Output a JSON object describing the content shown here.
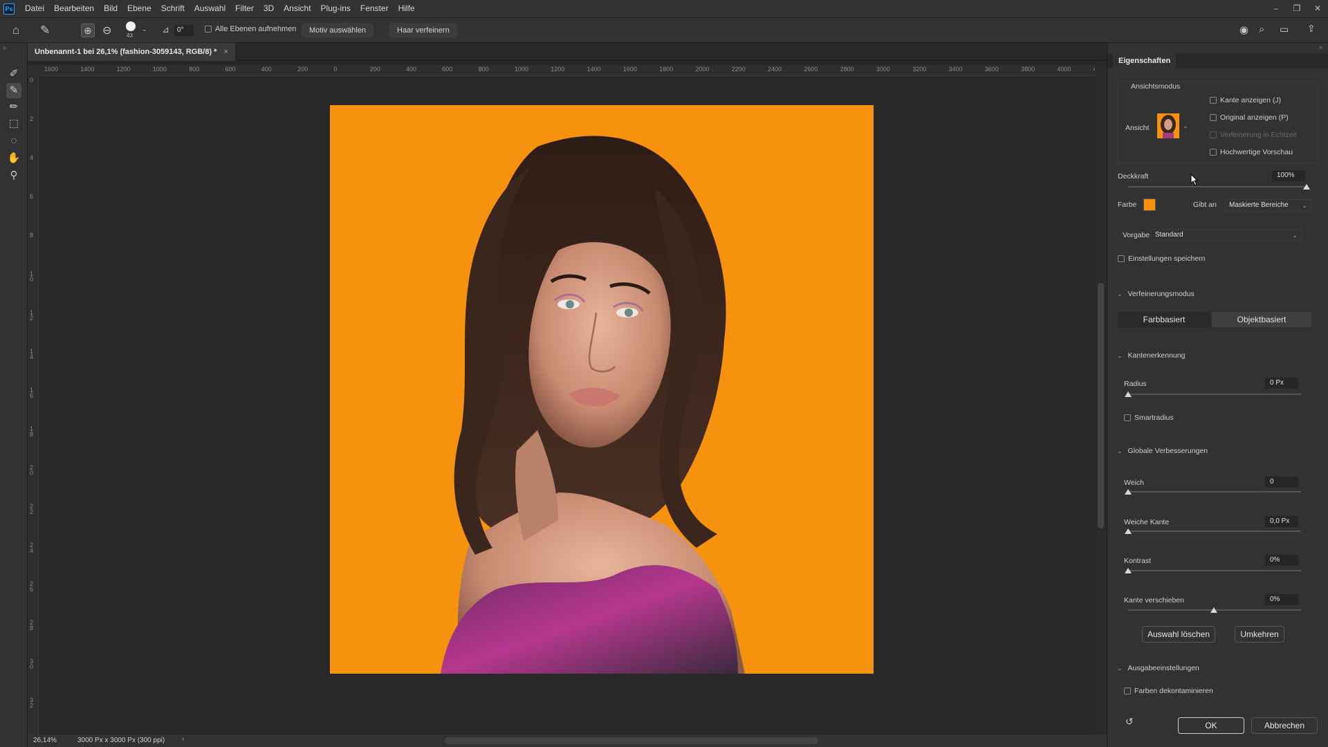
{
  "menubar": {
    "app_logo": "Ps",
    "items": [
      "Datei",
      "Bearbeiten",
      "Bild",
      "Ebene",
      "Schrift",
      "Auswahl",
      "Filter",
      "3D",
      "Ansicht",
      "Plug-ins",
      "Fenster",
      "Hilfe"
    ],
    "window_controls": [
      "–",
      "❐",
      "✕"
    ]
  },
  "options": {
    "brush_size": "43",
    "angle": "0°",
    "sample_all_layers": "Alle Ebenen aufnehmen",
    "select_subject": "Motiv auswählen",
    "refine_hair": "Haar verfeinern"
  },
  "document": {
    "tab_title": "Unbenannt-1 bei 26,1% (fashion-3059143, RGB/8) *",
    "close": "×",
    "zoom": "26,14%",
    "doc_info": "3000 Px x 3000 Px (300 ppi)",
    "background_color": "#f7920f"
  },
  "rulers": {
    "h_ticks": [
      "1600",
      "1400",
      "1200",
      "1000",
      "800",
      "600",
      "400",
      "200",
      "0",
      "200",
      "400",
      "600",
      "800",
      "1000",
      "1200",
      "1400",
      "1600",
      "1800",
      "2000",
      "2200",
      "2400",
      "2600",
      "2800",
      "3000",
      "3200",
      "3400",
      "3600",
      "3800",
      "4000",
      "4"
    ],
    "v_ticks": [
      "0",
      "2",
      "4",
      "6",
      "8",
      "1 0",
      "1 2",
      "1 4",
      "1 6",
      "1 8",
      "2 0",
      "2 2",
      "2 4",
      "2 6",
      "2 8",
      "3 0",
      "3 2"
    ]
  },
  "panel": {
    "tab": "Eigenschaften",
    "view_mode_title": "Ansichtsmodus",
    "view_label": "Ansicht",
    "show_edge": "Kante anzeigen (J)",
    "show_original": "Original anzeigen (P)",
    "realtime_refine": "Verfeinerung in Echtzeit",
    "hq_preview": "Hochwertige Vorschau",
    "opacity_label": "Deckkraft",
    "opacity_value": "100%",
    "opacity_level": 1.0,
    "color_label": "Farbe",
    "color_swatch": "#f7920f",
    "indicates_label": "Gibt an",
    "indicates_value": "Maskierte Bereiche",
    "preset_label": "Vorgabe",
    "preset_value": "Standard",
    "save_settings": "Einstellungen speichern",
    "refine_mode_title": "Verfeinerungsmodus",
    "color_aware": "Farbbasiert",
    "object_aware": "Objektbasiert",
    "edge_detection_title": "Kantenerkennung",
    "radius_label": "Radius",
    "radius_value": "0 Px",
    "smart_radius": "Smartradius",
    "global_title": "Globale Verbesserungen",
    "smooth_label": "Weich",
    "smooth_value": "0",
    "feather_label": "Weiche Kante",
    "feather_value": "0,0 Px",
    "contrast_label": "Kontrast",
    "contrast_value": "0%",
    "shift_edge_label": "Kante verschieben",
    "shift_edge_value": "0%",
    "clear_selection": "Auswahl löschen",
    "invert": "Umkehren",
    "output_title": "Ausgabeeinstellungen",
    "decontaminate": "Farben dekontaminieren",
    "ok": "OK",
    "cancel": "Abbrechen"
  }
}
